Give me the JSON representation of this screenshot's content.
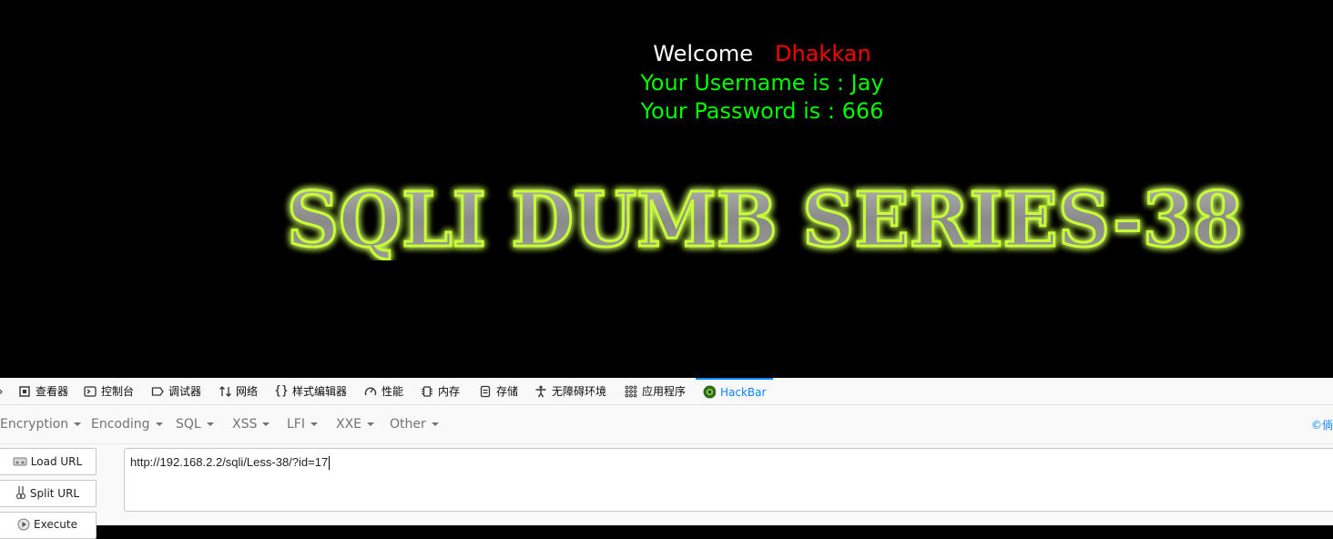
{
  "page": {
    "welcome": "Welcome",
    "name": "Dhakkan",
    "username_line": "Your Username is : Jay",
    "password_line": "Your Password is : 666",
    "banner": "SQLI DUMB SERIES-38"
  },
  "devtools": {
    "tabs": [
      {
        "label": "查看器",
        "icon": "inspector-icon"
      },
      {
        "label": "控制台",
        "icon": "console-icon"
      },
      {
        "label": "调试器",
        "icon": "debugger-icon"
      },
      {
        "label": "网络",
        "icon": "network-icon"
      },
      {
        "label": "样式编辑器",
        "icon": "style-editor-icon"
      },
      {
        "label": "性能",
        "icon": "performance-icon"
      },
      {
        "label": "内存",
        "icon": "memory-icon"
      },
      {
        "label": "存储",
        "icon": "storage-icon"
      },
      {
        "label": "无障碍环境",
        "icon": "accessibility-icon"
      },
      {
        "label": "应用程序",
        "icon": "application-icon"
      },
      {
        "label": "HackBar",
        "icon": "hackbar-icon"
      }
    ],
    "menus": [
      "Encryption",
      "Encoding",
      "SQL",
      "XSS",
      "LFI",
      "XXE",
      "Other"
    ],
    "copyright": "©倘",
    "buttons": {
      "load_url": "Load URL",
      "split_url": "Split URL",
      "execute": "Execute"
    },
    "url_value": "http://192.168.2.2/sqli/Less-38/?id=17"
  },
  "colors": {
    "name": "#ff0000",
    "creds": "#00ff00",
    "accent": "#0a84ff",
    "glow": "#b6ff1c"
  }
}
